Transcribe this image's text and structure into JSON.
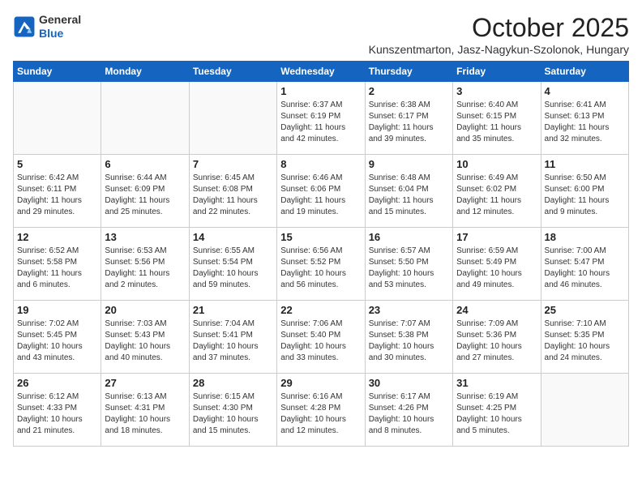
{
  "header": {
    "logo_line1": "General",
    "logo_line2": "Blue",
    "month": "October 2025",
    "location": "Kunszentmarton, Jasz-Nagykun-Szolonok, Hungary"
  },
  "weekdays": [
    "Sunday",
    "Monday",
    "Tuesday",
    "Wednesday",
    "Thursday",
    "Friday",
    "Saturday"
  ],
  "weeks": [
    [
      {
        "day": "",
        "info": ""
      },
      {
        "day": "",
        "info": ""
      },
      {
        "day": "",
        "info": ""
      },
      {
        "day": "1",
        "info": "Sunrise: 6:37 AM\nSunset: 6:19 PM\nDaylight: 11 hours\nand 42 minutes."
      },
      {
        "day": "2",
        "info": "Sunrise: 6:38 AM\nSunset: 6:17 PM\nDaylight: 11 hours\nand 39 minutes."
      },
      {
        "day": "3",
        "info": "Sunrise: 6:40 AM\nSunset: 6:15 PM\nDaylight: 11 hours\nand 35 minutes."
      },
      {
        "day": "4",
        "info": "Sunrise: 6:41 AM\nSunset: 6:13 PM\nDaylight: 11 hours\nand 32 minutes."
      }
    ],
    [
      {
        "day": "5",
        "info": "Sunrise: 6:42 AM\nSunset: 6:11 PM\nDaylight: 11 hours\nand 29 minutes."
      },
      {
        "day": "6",
        "info": "Sunrise: 6:44 AM\nSunset: 6:09 PM\nDaylight: 11 hours\nand 25 minutes."
      },
      {
        "day": "7",
        "info": "Sunrise: 6:45 AM\nSunset: 6:08 PM\nDaylight: 11 hours\nand 22 minutes."
      },
      {
        "day": "8",
        "info": "Sunrise: 6:46 AM\nSunset: 6:06 PM\nDaylight: 11 hours\nand 19 minutes."
      },
      {
        "day": "9",
        "info": "Sunrise: 6:48 AM\nSunset: 6:04 PM\nDaylight: 11 hours\nand 15 minutes."
      },
      {
        "day": "10",
        "info": "Sunrise: 6:49 AM\nSunset: 6:02 PM\nDaylight: 11 hours\nand 12 minutes."
      },
      {
        "day": "11",
        "info": "Sunrise: 6:50 AM\nSunset: 6:00 PM\nDaylight: 11 hours\nand 9 minutes."
      }
    ],
    [
      {
        "day": "12",
        "info": "Sunrise: 6:52 AM\nSunset: 5:58 PM\nDaylight: 11 hours\nand 6 minutes."
      },
      {
        "day": "13",
        "info": "Sunrise: 6:53 AM\nSunset: 5:56 PM\nDaylight: 11 hours\nand 2 minutes."
      },
      {
        "day": "14",
        "info": "Sunrise: 6:55 AM\nSunset: 5:54 PM\nDaylight: 10 hours\nand 59 minutes."
      },
      {
        "day": "15",
        "info": "Sunrise: 6:56 AM\nSunset: 5:52 PM\nDaylight: 10 hours\nand 56 minutes."
      },
      {
        "day": "16",
        "info": "Sunrise: 6:57 AM\nSunset: 5:50 PM\nDaylight: 10 hours\nand 53 minutes."
      },
      {
        "day": "17",
        "info": "Sunrise: 6:59 AM\nSunset: 5:49 PM\nDaylight: 10 hours\nand 49 minutes."
      },
      {
        "day": "18",
        "info": "Sunrise: 7:00 AM\nSunset: 5:47 PM\nDaylight: 10 hours\nand 46 minutes."
      }
    ],
    [
      {
        "day": "19",
        "info": "Sunrise: 7:02 AM\nSunset: 5:45 PM\nDaylight: 10 hours\nand 43 minutes."
      },
      {
        "day": "20",
        "info": "Sunrise: 7:03 AM\nSunset: 5:43 PM\nDaylight: 10 hours\nand 40 minutes."
      },
      {
        "day": "21",
        "info": "Sunrise: 7:04 AM\nSunset: 5:41 PM\nDaylight: 10 hours\nand 37 minutes."
      },
      {
        "day": "22",
        "info": "Sunrise: 7:06 AM\nSunset: 5:40 PM\nDaylight: 10 hours\nand 33 minutes."
      },
      {
        "day": "23",
        "info": "Sunrise: 7:07 AM\nSunset: 5:38 PM\nDaylight: 10 hours\nand 30 minutes."
      },
      {
        "day": "24",
        "info": "Sunrise: 7:09 AM\nSunset: 5:36 PM\nDaylight: 10 hours\nand 27 minutes."
      },
      {
        "day": "25",
        "info": "Sunrise: 7:10 AM\nSunset: 5:35 PM\nDaylight: 10 hours\nand 24 minutes."
      }
    ],
    [
      {
        "day": "26",
        "info": "Sunrise: 6:12 AM\nSunset: 4:33 PM\nDaylight: 10 hours\nand 21 minutes."
      },
      {
        "day": "27",
        "info": "Sunrise: 6:13 AM\nSunset: 4:31 PM\nDaylight: 10 hours\nand 18 minutes."
      },
      {
        "day": "28",
        "info": "Sunrise: 6:15 AM\nSunset: 4:30 PM\nDaylight: 10 hours\nand 15 minutes."
      },
      {
        "day": "29",
        "info": "Sunrise: 6:16 AM\nSunset: 4:28 PM\nDaylight: 10 hours\nand 12 minutes."
      },
      {
        "day": "30",
        "info": "Sunrise: 6:17 AM\nSunset: 4:26 PM\nDaylight: 10 hours\nand 8 minutes."
      },
      {
        "day": "31",
        "info": "Sunrise: 6:19 AM\nSunset: 4:25 PM\nDaylight: 10 hours\nand 5 minutes."
      },
      {
        "day": "",
        "info": ""
      }
    ]
  ]
}
